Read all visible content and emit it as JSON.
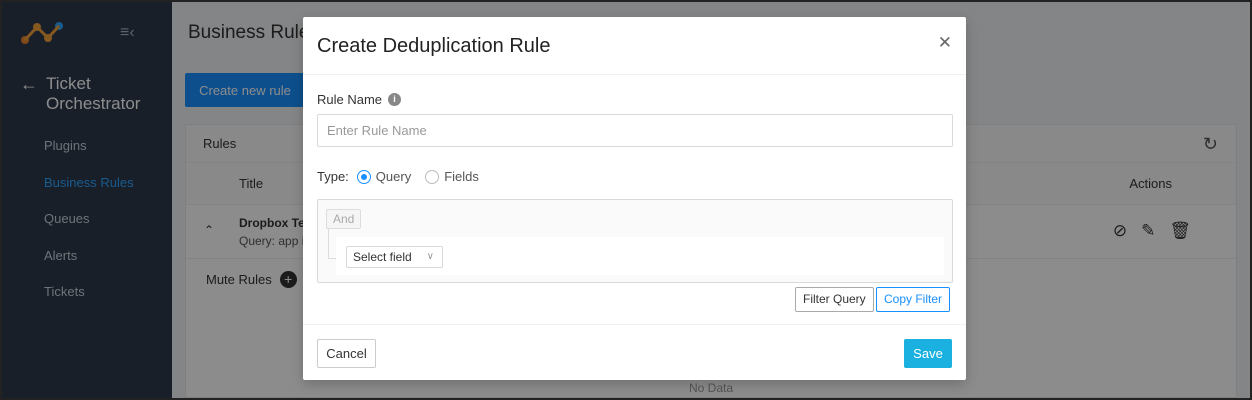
{
  "sidebar": {
    "app_title_line1": "Ticket",
    "app_title_line2": "Orchestrator",
    "items": [
      {
        "label": "Plugins",
        "active": false
      },
      {
        "label": "Business Rules",
        "active": true
      },
      {
        "label": "Queues",
        "active": false
      },
      {
        "label": "Alerts",
        "active": false
      },
      {
        "label": "Tickets",
        "active": false
      }
    ]
  },
  "page": {
    "title": "Business Rules",
    "create_button": "Create new rule",
    "rules_header": "Rules",
    "columns": {
      "title": "Title",
      "actions": "Actions"
    },
    "rows": [
      {
        "name": "Dropbox Test",
        "query": "Query: app is"
      }
    ],
    "mute_rules_label": "Mute Rules",
    "no_data": "No Data"
  },
  "modal": {
    "title": "Create Deduplication Rule",
    "rule_name_label": "Rule Name",
    "rule_name_placeholder": "Enter Rule Name",
    "rule_name_value": "",
    "type_label": "Type:",
    "type_options": [
      {
        "label": "Query",
        "selected": true
      },
      {
        "label": "Fields",
        "selected": false
      }
    ],
    "and_label": "And",
    "select_field_label": "Select field",
    "filter_query_button": "Filter Query",
    "copy_filter_button": "Copy Filter",
    "cancel_button": "Cancel",
    "save_button": "Save"
  },
  "colors": {
    "sidebar_bg": "#2d3a4b",
    "accent": "#1890ff",
    "save_button": "#1ab0e0"
  }
}
